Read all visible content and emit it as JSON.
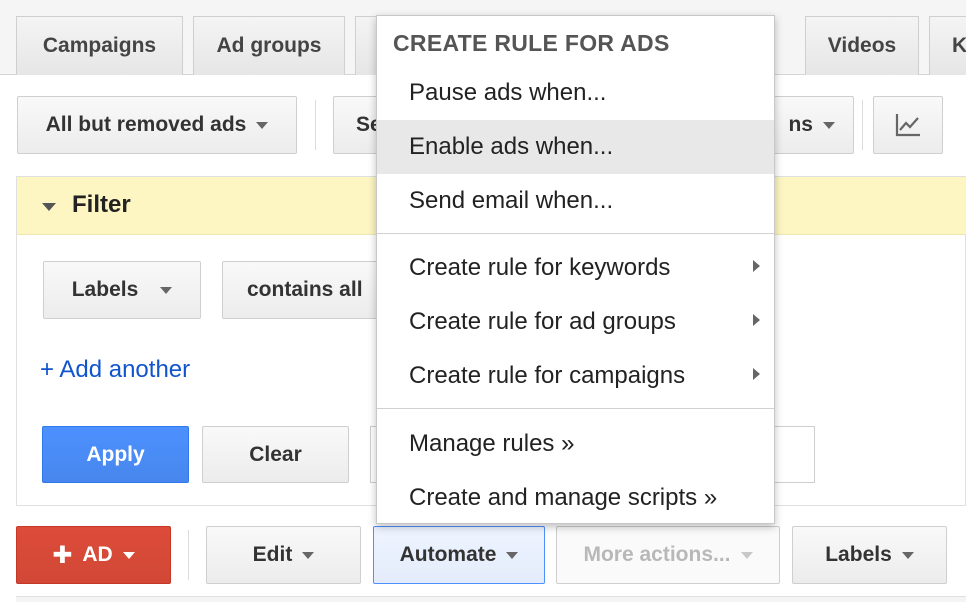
{
  "tabs": [
    "Campaigns",
    "Ad groups",
    "Videos",
    "K"
  ],
  "toolbar": {
    "view_filter": "All but removed ads",
    "segment_partial": "Se",
    "columns_partial": "ns"
  },
  "filter": {
    "title": "Filter",
    "field_label": "Labels",
    "operator_partial": "contains all",
    "add_another": "+ Add another",
    "apply_label": "Apply",
    "clear_label": "Clear"
  },
  "actions": {
    "add_label": "AD",
    "edit_label": "Edit",
    "automate_label": "Automate",
    "more_actions_label": "More actions...",
    "labels_label": "Labels"
  },
  "menu": {
    "header": "CREATE RULE FOR ADS",
    "group1": [
      "Pause ads when...",
      "Enable ads when...",
      "Send email when..."
    ],
    "group2": [
      "Create rule for keywords",
      "Create rule for ad groups",
      "Create rule for campaigns"
    ],
    "group3": [
      "Manage rules »",
      "Create and manage scripts »"
    ]
  },
  "colors": {
    "primary_blue": "#4d90fe",
    "red_action": "#d14836",
    "filter_bg": "#fdf6c3",
    "link_blue": "#1155cc"
  }
}
